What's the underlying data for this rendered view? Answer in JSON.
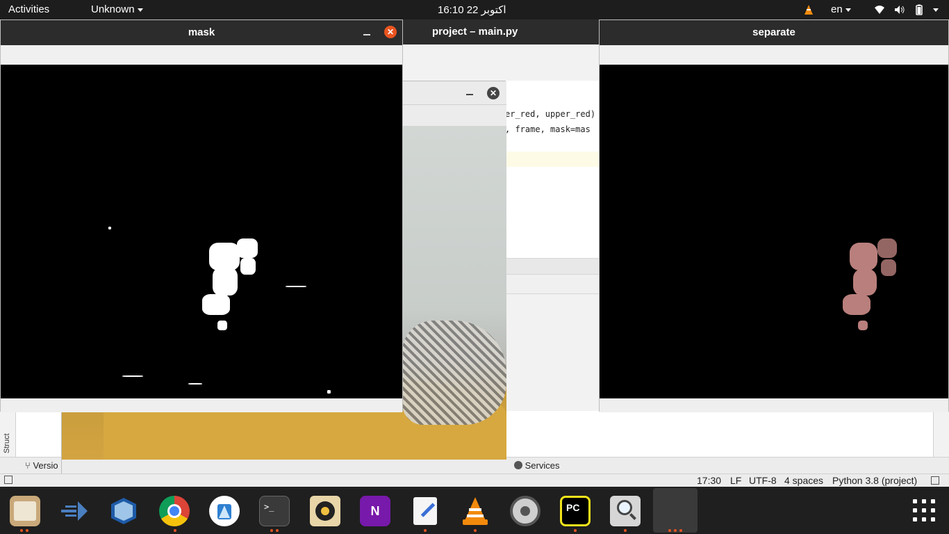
{
  "topbar": {
    "activities": "Activities",
    "app_menu": "Unknown",
    "clock": "16:10  22 اکتوبر",
    "language": "en"
  },
  "pycharm": {
    "title": "project – main.py",
    "code_lines": [
      "er_red, upper_red)",
      ", frame, mask=mas"
    ],
    "tool_left": "Versio",
    "tool_services": "Services",
    "side_label": "Struct",
    "status": {
      "position": "17:30",
      "line_sep": "LF",
      "encoding": "UTF-8",
      "indent": "4 spaces",
      "interpreter": "Python 3.8 (project)"
    }
  },
  "windows": {
    "mask": {
      "title": "mask"
    },
    "separate": {
      "title": "separate"
    },
    "camera": {
      "title": ""
    }
  },
  "dock": {
    "items": [
      {
        "name": "files"
      },
      {
        "name": "tool"
      },
      {
        "name": "virtualbox"
      },
      {
        "name": "chrome"
      },
      {
        "name": "android-studio"
      },
      {
        "name": "terminal"
      },
      {
        "name": "rhythmbox"
      },
      {
        "name": "onenote"
      },
      {
        "name": "text-editor"
      },
      {
        "name": "vlc"
      },
      {
        "name": "settings"
      },
      {
        "name": "pycharm"
      },
      {
        "name": "image-viewer"
      },
      {
        "name": "running-app"
      }
    ]
  },
  "colors": {
    "accent": "#e95420",
    "topbar": "#1d1d1d",
    "dock": "#1f1f1f"
  }
}
